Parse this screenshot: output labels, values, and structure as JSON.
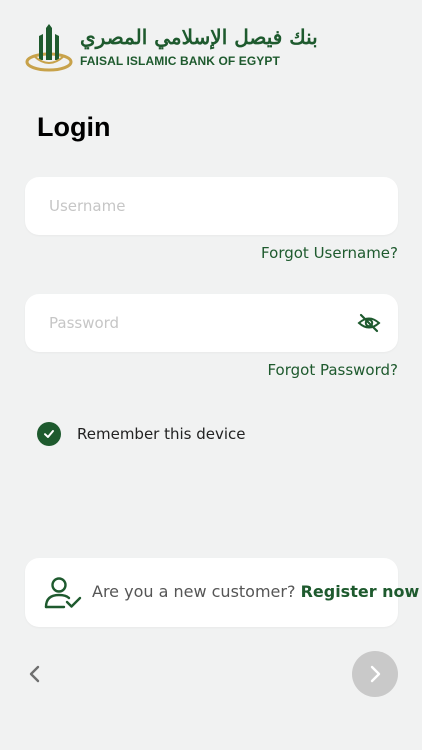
{
  "brand": {
    "name_ar": "بنك فيصل الإسلامي المصري",
    "name_en": "FAISAL ISLAMIC BANK OF EGYPT",
    "color": "#1e5a2e",
    "accent": "#c8a24a"
  },
  "login": {
    "title": "Login",
    "username_placeholder": "Username",
    "forgot_username": "Forgot Username?",
    "password_placeholder": "Password",
    "forgot_password": "Forgot Password?",
    "remember_label": "Remember this device",
    "remember_checked": true
  },
  "register": {
    "prompt": "Are you a new customer?",
    "link": "Register now"
  },
  "nav": {
    "back_icon": "chevron-left-icon",
    "next_icon": "chevron-right-icon"
  }
}
